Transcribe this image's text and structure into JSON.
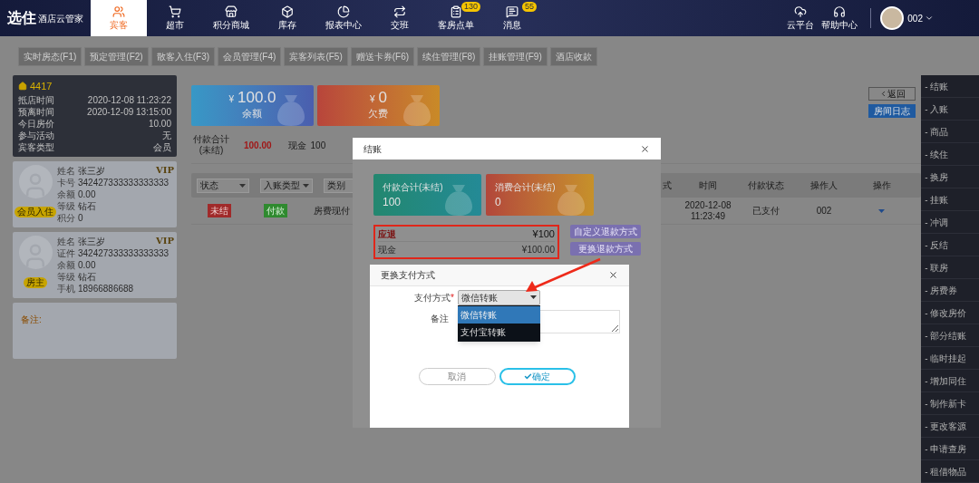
{
  "nav": {
    "brand": "选住",
    "product": "酒店云管家",
    "items": [
      {
        "label": "宾客",
        "kind": "guests",
        "selected": true
      },
      {
        "label": "超市",
        "kind": "market",
        "selected": false
      },
      {
        "label": "积分商城",
        "kind": "store",
        "selected": false
      },
      {
        "label": "库存",
        "kind": "stock",
        "selected": false
      },
      {
        "label": "报表中心",
        "kind": "reports",
        "selected": false
      },
      {
        "label": "交班",
        "kind": "shift",
        "selected": false
      },
      {
        "label": "客房点单",
        "kind": "orders",
        "selected": false,
        "badge": "130"
      },
      {
        "label": "消息",
        "kind": "messages",
        "selected": false,
        "badge": "55"
      }
    ],
    "right_items": [
      {
        "label": "云平台",
        "kind": "cloud"
      },
      {
        "label": "帮助中心",
        "kind": "help"
      }
    ],
    "user": "002"
  },
  "subtabs": [
    "实时房态(F1)",
    "预定管理(F2)",
    "散客入住(F3)",
    "会员管理(F4)",
    "宾客列表(F5)",
    "赠送卡券(F6)",
    "续住管理(F8)",
    "挂账管理(F9)",
    "酒店收款"
  ],
  "room": {
    "number": "4417",
    "fields": [
      {
        "label": "抵店时间",
        "value": "2020-12-08 11:23:22"
      },
      {
        "label": "预离时间",
        "value": "2020-12-09 13:15:00"
      },
      {
        "label": "今日房价",
        "value": "10.00"
      },
      {
        "label": "参与活动",
        "value": "无"
      },
      {
        "label": "宾客类型",
        "value": "会员"
      }
    ]
  },
  "guests": [
    {
      "vip": "VIP",
      "tag": "会员入住",
      "fields": [
        {
          "label": "姓名",
          "value": "张三岁"
        },
        {
          "label": "卡号",
          "value": "342427333333333333"
        },
        {
          "label": "余额",
          "value": "0.00"
        },
        {
          "label": "等级",
          "value": "钻石"
        },
        {
          "label": "积分",
          "value": "0"
        }
      ]
    },
    {
      "vip": "VIP",
      "tag": "房主",
      "fields": [
        {
          "label": "姓名",
          "value": "张三岁"
        },
        {
          "label": "证件",
          "value": "342427333333333333"
        },
        {
          "label": "余额",
          "value": "0.00"
        },
        {
          "label": "等级",
          "value": "钻石"
        },
        {
          "label": "手机",
          "value": "18966886688"
        }
      ]
    }
  ],
  "note_label": "备注:",
  "summary_cards": [
    {
      "kind": "balance",
      "currency": "¥",
      "amount": "100.0",
      "label": "余额"
    },
    {
      "kind": "debt",
      "currency": "¥",
      "amount": "0",
      "label": "欠费"
    }
  ],
  "back_button": "返回",
  "log_button": "房间日志",
  "payment_total": {
    "label": "付款合计",
    "sub": "(未结)",
    "value": "100.00",
    "cash_label": "现金",
    "cash_value": "100"
  },
  "table": {
    "filters": [
      "状态",
      "入账类型",
      "类别"
    ],
    "columns": [
      "式",
      "时间",
      "付款状态",
      "操作人",
      "操作"
    ],
    "rows": [
      {
        "status": "未结",
        "entry_type": "付款",
        "category": "房费现付",
        "time": "2020-12-08\n11:23:49",
        "pay_status": "已支付",
        "operator": "002"
      }
    ]
  },
  "actions": [
    "- 结账",
    "- 入账",
    "- 商品",
    "- 续住",
    "- 换房",
    "- 挂账",
    "- 冲调",
    "- 反结",
    "- 联房",
    "- 房费券",
    "- 修改房价",
    "- 部分结账",
    "- 临时挂起",
    "- 增加同住",
    "- 制作新卡",
    "- 更改客源",
    "- 申请查房",
    "- 租借物品"
  ],
  "checkout_dialog": {
    "title": "结账",
    "cards": [
      {
        "kind": "paid",
        "label": "付款合计(未结)",
        "value": "100"
      },
      {
        "kind": "spent",
        "label": "消费合计(未结)",
        "value": "0"
      }
    ],
    "refund": {
      "label": "应退",
      "amount": "¥100",
      "method": "现金",
      "method_amount": "¥100.00"
    },
    "buttons": [
      "自定义退款方式",
      "更换退款方式"
    ]
  },
  "change_dialog": {
    "title": "更换支付方式",
    "method": {
      "label": "支付方式",
      "required_mark": "*",
      "value": "微信转账",
      "options": [
        {
          "label": "微信转账",
          "selected": true
        },
        {
          "label": "支付宝转账",
          "selected": false
        }
      ]
    },
    "note": {
      "label": "备注"
    },
    "cancel": "取消",
    "confirm": "确定"
  }
}
